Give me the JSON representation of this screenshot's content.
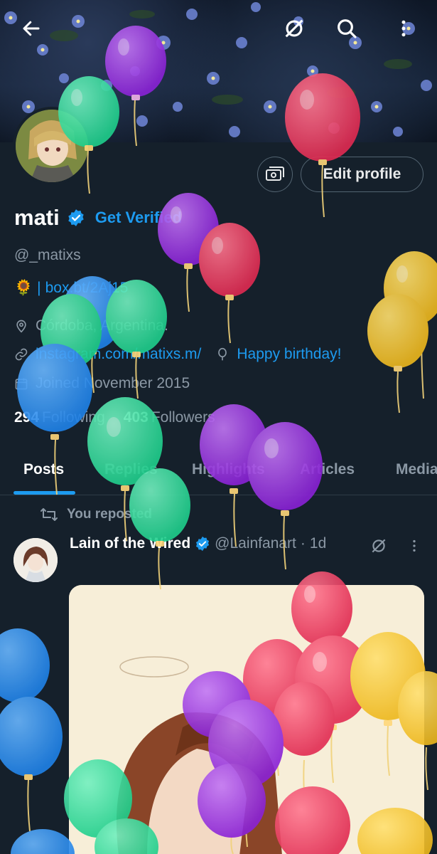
{
  "header": {
    "back_icon": "arrow-left-icon",
    "icons": [
      "spaces-icon",
      "search-icon",
      "more-vertical-icon"
    ]
  },
  "profile": {
    "name": "mati",
    "get_verified": "Get Verified",
    "handle": "@_matixs",
    "bio_emoji": "🌻",
    "bio_separator": "|",
    "bio_link": "box.bt/2Aj15",
    "location": "Córdoba, Argentina.",
    "website": "instagram.com/matixs.m/",
    "birthday": "Happy birthday!",
    "joined": "Joined November 2015",
    "following_count": "294",
    "following_label": "Following",
    "followers_count": "403",
    "followers_label": "Followers"
  },
  "actions": {
    "edit_profile": "Edit profile"
  },
  "tabs": [
    {
      "label": "Posts"
    },
    {
      "label": "Replies"
    },
    {
      "label": "Highlights"
    },
    {
      "label": "Articles"
    },
    {
      "label": "Media"
    }
  ],
  "post": {
    "repost_label": "You reposted",
    "author": "Lain of the Wired",
    "handle": "@Lainfanart",
    "separator": "·",
    "time": "1d"
  },
  "colors": {
    "background": "#15202b",
    "accent": "#1d9bf0",
    "muted": "#8b98a5",
    "balloon_purple": "#9b30e0",
    "balloon_red": "#e8375d",
    "balloon_green": "#2fd89a",
    "balloon_blue": "#2b8ff0",
    "balloon_yellow": "#f2c32c"
  }
}
